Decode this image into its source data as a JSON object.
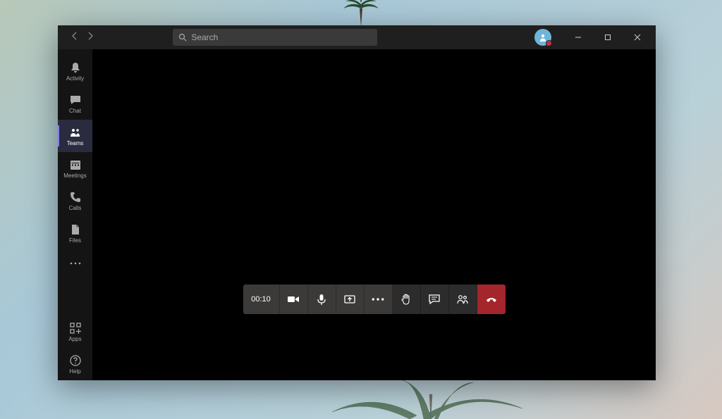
{
  "search": {
    "placeholder": "Search"
  },
  "sidebar": {
    "items": [
      {
        "id": "activity",
        "label": "Activity"
      },
      {
        "id": "chat",
        "label": "Chat"
      },
      {
        "id": "teams",
        "label": "Teams"
      },
      {
        "id": "meetings",
        "label": "Meetings"
      },
      {
        "id": "calls",
        "label": "Calls"
      },
      {
        "id": "files",
        "label": "Files"
      }
    ],
    "apps_label": "Apps",
    "help_label": "Help"
  },
  "call": {
    "timer": "00:10",
    "status_color": "#c4314b",
    "hangup_color": "#a4262c"
  }
}
